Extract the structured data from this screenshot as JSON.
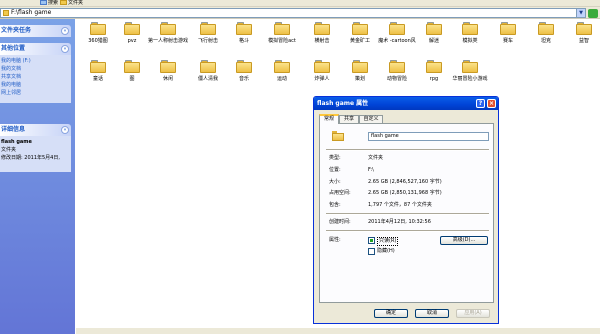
{
  "toolbar": {
    "folder_label": "文件夹",
    "search_label": "搜索"
  },
  "address": {
    "path": "F:\\flash game",
    "go_color": "#3cab3c"
  },
  "taskpane": {
    "tasks_panel_title": "文件夹任务",
    "other_places_title": "其他位置",
    "other_places": [
      "我的电脑 (F:)",
      "我的文档",
      "共享文档",
      "我的电脑",
      "网上邻居"
    ],
    "details_title": "详细信息",
    "details_name": "flash game",
    "details_type": "文件夹",
    "details_modified": "修改日期: 2011年5月4日,"
  },
  "folders": [
    "360猎图",
    "pvz",
    "第一人称射击游戏",
    "飞行射击",
    "格斗",
    "模拟冒险act",
    "横射击",
    "黄金矿工",
    "魔术 -cartoon风",
    "解迷",
    "模拟类",
    "赛车",
    "坦克",
    "益智",
    "童话",
    "图",
    "休闲",
    "僵人清我",
    "音乐",
    "运动",
    "炸弹人",
    "策划",
    "动物冒险",
    "rpg",
    "华丽冒险小游戏"
  ],
  "dialog": {
    "title": "flash game 属性",
    "help": "?",
    "close": "×",
    "tabs": [
      "常规",
      "共享",
      "自定义"
    ],
    "name_value": "flash game",
    "rows": [
      {
        "label": "类型:",
        "value": "文件夹"
      },
      {
        "label": "位置:",
        "value": "F:\\"
      },
      {
        "label": "大小:",
        "value": "2.65 GB (2,846,527,160 字节)"
      },
      {
        "label": "占用空间:",
        "value": "2.65 GB (2,850,131,968 字节)"
      },
      {
        "label": "包含:",
        "value": "1,797 个文件，87 个文件夹"
      },
      {
        "label": "创建时间:",
        "value": "2011年4月12日, 10:32:56"
      }
    ],
    "attributes_label": "属性:",
    "readonly_label": "只读(R)",
    "hidden_label": "隐藏(H)",
    "advanced_button": "高级(D)...",
    "ok_button": "确定",
    "cancel_button": "取消",
    "apply_button": "应用(A)"
  }
}
